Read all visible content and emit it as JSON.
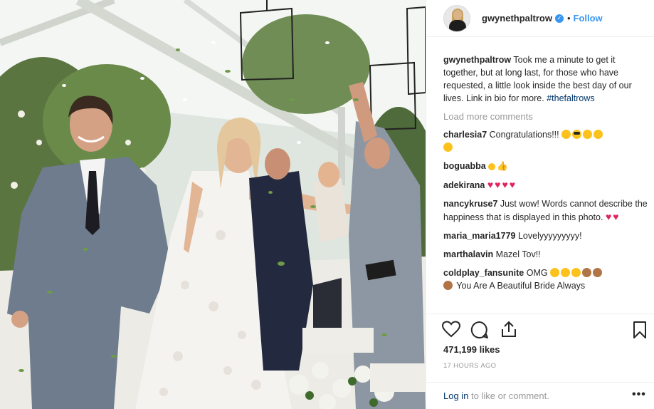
{
  "post": {
    "username": "gwynethpaltrow",
    "verified_icon": "verified-badge-icon",
    "separator": "•",
    "follow_label": "Follow"
  },
  "caption": {
    "username": "gwynethpaltrow",
    "text": "Took me a minute to get it together, but at long last, for those who have requested, a little look inside the best day of our lives. Link in bio for more.",
    "hashtag": "#thefaltrows"
  },
  "load_more": "Load more comments",
  "comments": [
    {
      "username": "charlesia7",
      "text": "Congratulations!!!"
    },
    {
      "username": "boguabba",
      "text": ""
    },
    {
      "username": "adekirana",
      "text": ""
    },
    {
      "username": "nancykruse7",
      "text": "Just wow! Words cannot describe the happiness that is displayed in this photo."
    },
    {
      "username": "maria_maria1779",
      "text": "Lovelyyyyyyyyy!"
    },
    {
      "username": "marthalavin",
      "text": "Mazel Tov!!"
    },
    {
      "username": "coldplay_fansunite",
      "text": "OMG",
      "text2": "You Are A Beautiful Bride Always"
    }
  ],
  "actions": {
    "like_icon": "heart-icon",
    "comment_icon": "comment-icon",
    "share_icon": "share-icon",
    "save_icon": "bookmark-icon"
  },
  "likes": "471,199 likes",
  "time": "17 HOURS AGO",
  "footer": {
    "login_link": "Log in",
    "login_text": "to like or comment.",
    "more": "•••"
  },
  "colors": {
    "link_blue": "#3897f0",
    "text": "#262626",
    "muted": "#999999",
    "border": "#efefef",
    "hashtag": "#003569"
  }
}
